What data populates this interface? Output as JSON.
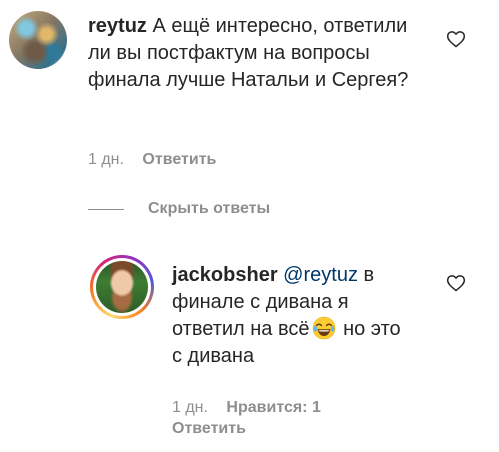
{
  "comment": {
    "username": "reytuz",
    "text": "А ещё интересно, ответили ли вы постфактум на вопросы финала лучше Натальи и Сергея?",
    "time": "1 дн.",
    "reply_label": "Ответить"
  },
  "replies_toggle": {
    "label": "Скрыть ответы"
  },
  "reply": {
    "username": "jackobsher",
    "mention": "@reytuz",
    "text_before_emoji": "в финале с дивана я ответил на всё",
    "emoji": "face-with-tears-of-joy",
    "text_after_emoji": "но это с дивана",
    "time": "1 дн.",
    "likes_label": "Нравится: 1",
    "reply_label": "Ответить"
  },
  "colors": {
    "text": "#262626",
    "secondary": "#8e8e8e",
    "mention": "#00376b"
  }
}
